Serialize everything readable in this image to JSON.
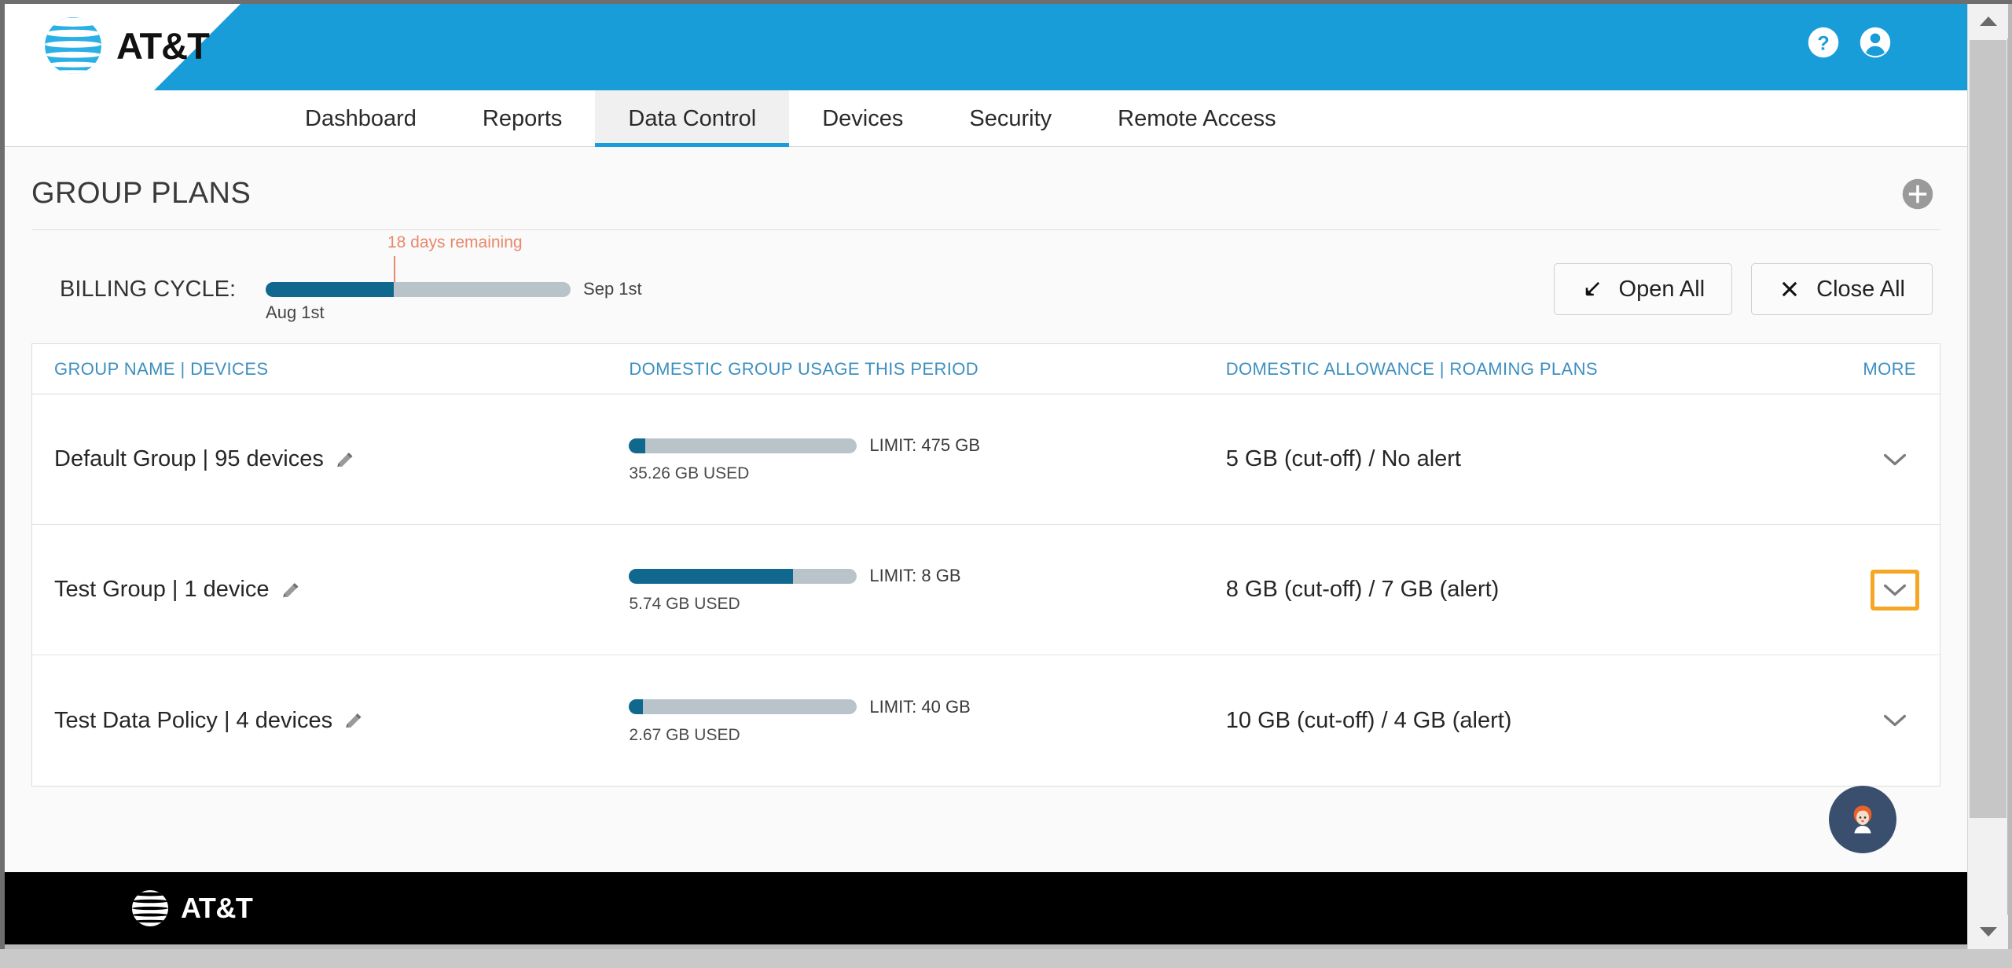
{
  "brand": {
    "name": "AT&T",
    "globe_icon": "att-globe-icon",
    "header_blue": "#199dd9"
  },
  "header": {
    "help_icon": "help-circle-icon",
    "account_icon": "user-account-icon"
  },
  "nav": {
    "tabs": [
      {
        "label": "Dashboard",
        "active": false
      },
      {
        "label": "Reports",
        "active": false
      },
      {
        "label": "Data Control",
        "active": true
      },
      {
        "label": "Devices",
        "active": false
      },
      {
        "label": "Security",
        "active": false
      },
      {
        "label": "Remote Access",
        "active": false
      }
    ]
  },
  "page": {
    "title": "GROUP PLANS",
    "add_icon": "add-plus-circle-icon"
  },
  "billing": {
    "label": "BILLING CYCLE:",
    "days_remaining": "18 days remaining",
    "start_date": "Aug 1st",
    "end_date": "Sep 1st",
    "progress_percent": 42,
    "marker_percent": 42,
    "open_all_label": "Open All",
    "open_all_icon": "arrow-down-left-icon",
    "close_all_label": "Close All",
    "close_all_icon": "close-x-icon"
  },
  "table": {
    "headers": {
      "name": "GROUP NAME | DEVICES",
      "usage": "DOMESTIC GROUP USAGE THIS PERIOD",
      "allowance": "DOMESTIC ALLOWANCE | ROAMING PLANS",
      "more": "MORE"
    },
    "rows": [
      {
        "group": "Default Group | 95 devices",
        "edit_icon": "pencil-edit-icon",
        "used": "35.26 GB USED",
        "limit": "LIMIT: 475 GB",
        "usage_percent": 7,
        "allowance": "5 GB (cut-off) / No alert",
        "chevron_icon": "chevron-down-icon",
        "highlighted": false
      },
      {
        "group": "Test Group | 1 device",
        "edit_icon": "pencil-edit-icon",
        "used": "5.74 GB USED",
        "limit": "LIMIT: 8 GB",
        "usage_percent": 72,
        "allowance": "8 GB (cut-off) / 7 GB (alert)",
        "chevron_icon": "chevron-down-icon",
        "highlighted": true
      },
      {
        "group": "Test Data Policy | 4 devices",
        "edit_icon": "pencil-edit-icon",
        "used": "2.67 GB USED",
        "limit": "LIMIT: 40 GB",
        "usage_percent": 6,
        "allowance": "10 GB (cut-off) / 4 GB (alert)",
        "chevron_icon": "chevron-down-icon",
        "highlighted": false
      }
    ]
  },
  "chat": {
    "icon": "chat-agent-avatar-icon"
  },
  "footer": {
    "brand": "AT&T",
    "globe_icon": "att-globe-icon"
  },
  "scrollbar": {
    "up_icon": "scroll-up-arrow-icon",
    "down_icon": "scroll-down-arrow-icon"
  },
  "colors": {
    "brand_blue": "#199dd9",
    "bar_fill": "#10688f",
    "bar_track": "#b8c4c9",
    "highlight_orange": "#f5a623",
    "alert_salmon": "#e8896a",
    "header_link_blue": "#3d8fc0"
  }
}
